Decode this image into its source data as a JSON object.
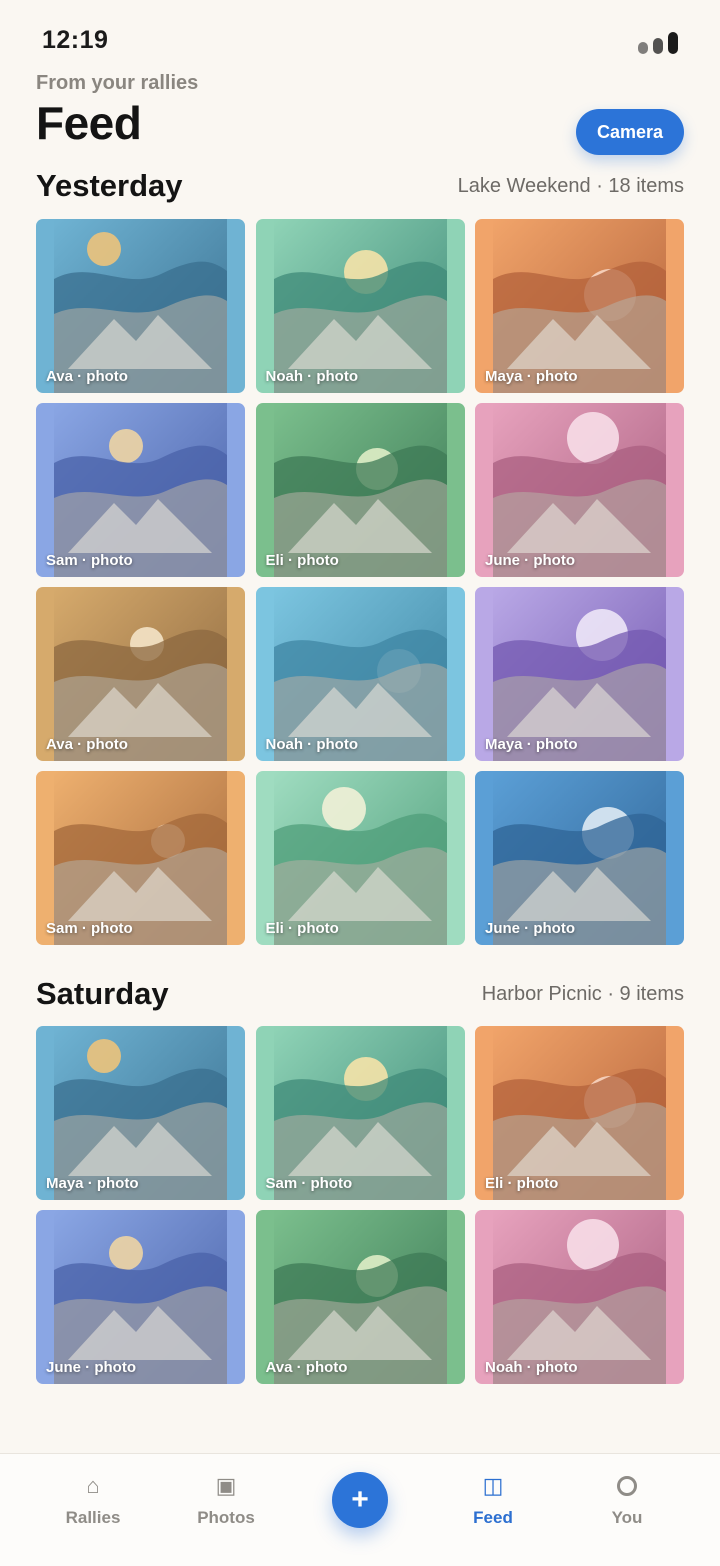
{
  "status": {
    "time": "12:19"
  },
  "header": {
    "eyebrow": "From your rallies",
    "title": "Feed",
    "camera_label": "Camera"
  },
  "sections": [
    {
      "title": "Yesterday",
      "meta": "Lake Weekend · 18 items",
      "tiles": [
        {
          "label": "Ava · photo",
          "palette": [
            "#6fb3d3",
            "#3a6f8f",
            "#e9c27d"
          ]
        },
        {
          "label": "Noah · photo",
          "palette": [
            "#8fd3b6",
            "#3f8a78",
            "#f2e2a8"
          ]
        },
        {
          "label": "Maya · photo",
          "palette": [
            "#f1a46a",
            "#b3623b",
            "#f6d4c0"
          ]
        },
        {
          "label": "Sam · photo",
          "palette": [
            "#8aa6e4",
            "#4a62a8",
            "#ecd2a4"
          ]
        },
        {
          "label": "Eli · photo",
          "palette": [
            "#7bbf8d",
            "#3d7a56",
            "#dcecc4"
          ]
        },
        {
          "label": "June · photo",
          "palette": [
            "#e7a2bd",
            "#a95f80",
            "#f6dbe6"
          ]
        },
        {
          "label": "Ava · photo",
          "palette": [
            "#d6aa6c",
            "#8c6840",
            "#f2e2c4"
          ]
        },
        {
          "label": "Noah · photo",
          "palette": [
            "#7cc5e0",
            "#3f86a3",
            "#b9d6e0"
          ]
        },
        {
          "label": "Maya · photo",
          "palette": [
            "#b9a8e6",
            "#7358b0",
            "#ebe4f6"
          ]
        },
        {
          "label": "Sam · photo",
          "palette": [
            "#eeb06f",
            "#a3683b",
            "#f6e0c6"
          ]
        },
        {
          "label": "Eli · photo",
          "palette": [
            "#9fdcc0",
            "#4f9d7a",
            "#eff0d6"
          ]
        },
        {
          "label": "June · photo",
          "palette": [
            "#5b9fd6",
            "#2f6496",
            "#dbe8f2"
          ]
        }
      ]
    },
    {
      "title": "Saturday",
      "meta": "Harbor Picnic · 9 items",
      "tiles": [
        {
          "label": "Maya · photo",
          "palette": [
            "#6fb3d3",
            "#3a6f8f",
            "#e9c27d"
          ]
        },
        {
          "label": "Sam · photo",
          "palette": [
            "#8fd3b6",
            "#3f8a78",
            "#f2e2a8"
          ]
        },
        {
          "label": "Eli · photo",
          "palette": [
            "#f1a46a",
            "#b3623b",
            "#f6d4c0"
          ]
        },
        {
          "label": "June · photo",
          "palette": [
            "#8aa6e4",
            "#4a62a8",
            "#ecd2a4"
          ]
        },
        {
          "label": "Ava · photo",
          "palette": [
            "#7bbf8d",
            "#3d7a56",
            "#dcecc4"
          ]
        },
        {
          "label": "Noah · photo",
          "palette": [
            "#e7a2bd",
            "#a95f80",
            "#f6dbe6"
          ]
        }
      ]
    }
  ],
  "tabs": [
    {
      "label": "Rallies",
      "icon": "home-icon"
    },
    {
      "label": "Photos",
      "icon": "photos-icon"
    },
    {
      "label": "Feed",
      "icon": "feed-icon",
      "active": true
    },
    {
      "label": "You",
      "icon": "profile-icon"
    }
  ],
  "colors": {
    "accent": "#2c74d8",
    "background": "#faf7f2"
  }
}
